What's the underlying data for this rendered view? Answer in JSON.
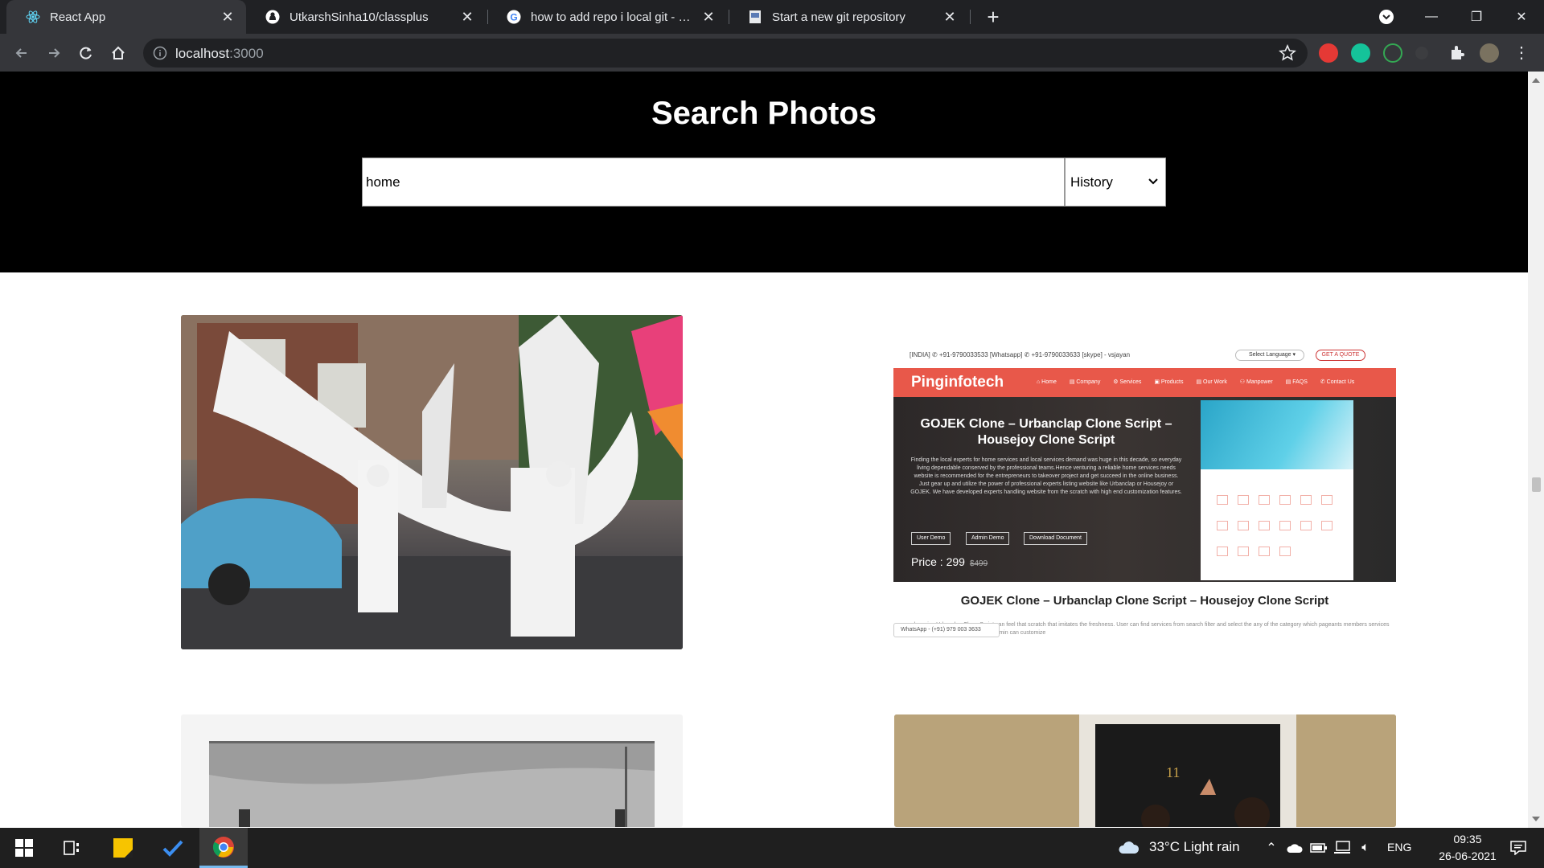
{
  "browser": {
    "tabs": [
      {
        "title": "React App",
        "active": true,
        "icon": "react-icon"
      },
      {
        "title": "UtkarshSinha10/classplus",
        "active": false,
        "icon": "github-icon"
      },
      {
        "title": "how to add repo i local git - Goo",
        "active": false,
        "icon": "google-icon"
      },
      {
        "title": "Start a new git repository",
        "active": false,
        "icon": "page-icon"
      }
    ],
    "url_host": "localhost",
    "url_port": ":3000",
    "colors": {
      "frame": "#202124",
      "toolbar": "#35363a"
    }
  },
  "page": {
    "title": "Search Photos",
    "search": {
      "value": "home"
    },
    "history_select": {
      "selected": "History"
    }
  },
  "photo_card": {
    "brand": "Pinginfotech",
    "topline": "[INDIA] ✆ +91-9790033533  [Whatsapp] ✆ +91-9790033633  [skype] - vsjayan",
    "language_button": "Select Language ▾",
    "quote_button": "GET A QUOTE",
    "menu": [
      "⌂ Home",
      "▤ Company",
      "⚙ Services",
      "▣ Products",
      "▤ Our Work",
      "⚇ Manpower",
      "▤ FAQS",
      "✆ Contact Us"
    ],
    "headline": "GOJEK Clone – Urbanclap Clone Script – Housejoy Clone Script",
    "body": "Finding the local experts for home services and local services demand was huge in this decade, so everyday living dependable conserved by the professional teams.Hence venturing a reliable home services needs website is recommended for the entrepreneurs to takeover project and get succeed in the online business. Just gear up and utilize the power of professional experts listing website like Urbanclap or Housejoy or GOJEK. We have developed experts handling website from the scratch with high end customization features.",
    "buttons": [
      "User Demo",
      "Admin Demo",
      "Download Document"
    ],
    "price_label": "Price : 299",
    "price_old": "$499",
    "caption": "GOJEK Clone – Urbanclap Clone Script – Housejoy Clone Script",
    "caption_small": "...onal service Urbanclap Clone Script can feel that scratch that imitates the freshness. User can find services from search filter and select the any of the category which pageants members services with details.Through Housejoy Script admin can customize",
    "whatsapp": "WhatsApp - (+91) 979 003 3633"
  },
  "taskbar": {
    "weather": "33°C  Light rain",
    "language": "ENG",
    "time": "09:35",
    "date": "26-06-2021"
  }
}
